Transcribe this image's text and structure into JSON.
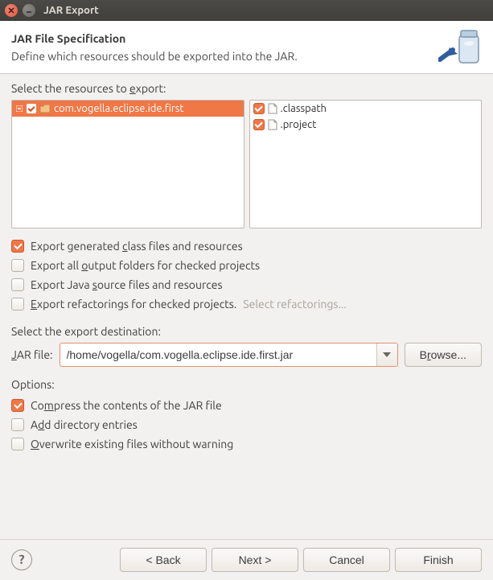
{
  "window": {
    "title": "JAR Export"
  },
  "header": {
    "title": "JAR File Specification",
    "subtitle": "Define which resources should be exported into the JAR."
  },
  "resources": {
    "label_pre": "Select the resources to ",
    "label_underlined": "e",
    "label_post": "xport:",
    "left_tree": [
      {
        "label": "com.vogella.eclipse.ide.first",
        "expanded": true,
        "checked": true,
        "selected": true
      }
    ],
    "right_files": [
      {
        "label": ".classpath",
        "checked": true
      },
      {
        "label": ".project",
        "checked": true
      }
    ]
  },
  "export_options": [
    {
      "label_parts": [
        "Export generated ",
        "c",
        "lass files and resources"
      ],
      "checked": true
    },
    {
      "label_parts": [
        "Export all ",
        "o",
        "utput folders for checked projects"
      ],
      "checked": false
    },
    {
      "label_parts": [
        "Export Java ",
        "s",
        "ource files and resources"
      ],
      "checked": false
    },
    {
      "label_parts": [
        "",
        "E",
        "xport refactorings for checked projects."
      ],
      "checked": false,
      "trailing_link": "Select refactorings..."
    }
  ],
  "destination": {
    "section_label": "Select the export destination:",
    "field_label_parts": [
      "",
      "J",
      "AR file:"
    ],
    "value": "/home/vogella/com.vogella.eclipse.ide.first.jar",
    "browse_parts": [
      "B",
      "r",
      "owse..."
    ]
  },
  "options": {
    "section_label": "Options:",
    "items": [
      {
        "label_parts": [
          "Co",
          "m",
          "press the contents of the JAR file"
        ],
        "checked": true
      },
      {
        "label_parts": [
          "A",
          "d",
          "d directory entries"
        ],
        "checked": false
      },
      {
        "label_parts": [
          "",
          "O",
          "verwrite existing files without warning"
        ],
        "checked": false
      }
    ]
  },
  "footer": {
    "back": "< Back",
    "next": "Next >",
    "cancel": "Cancel",
    "finish": "Finish"
  }
}
